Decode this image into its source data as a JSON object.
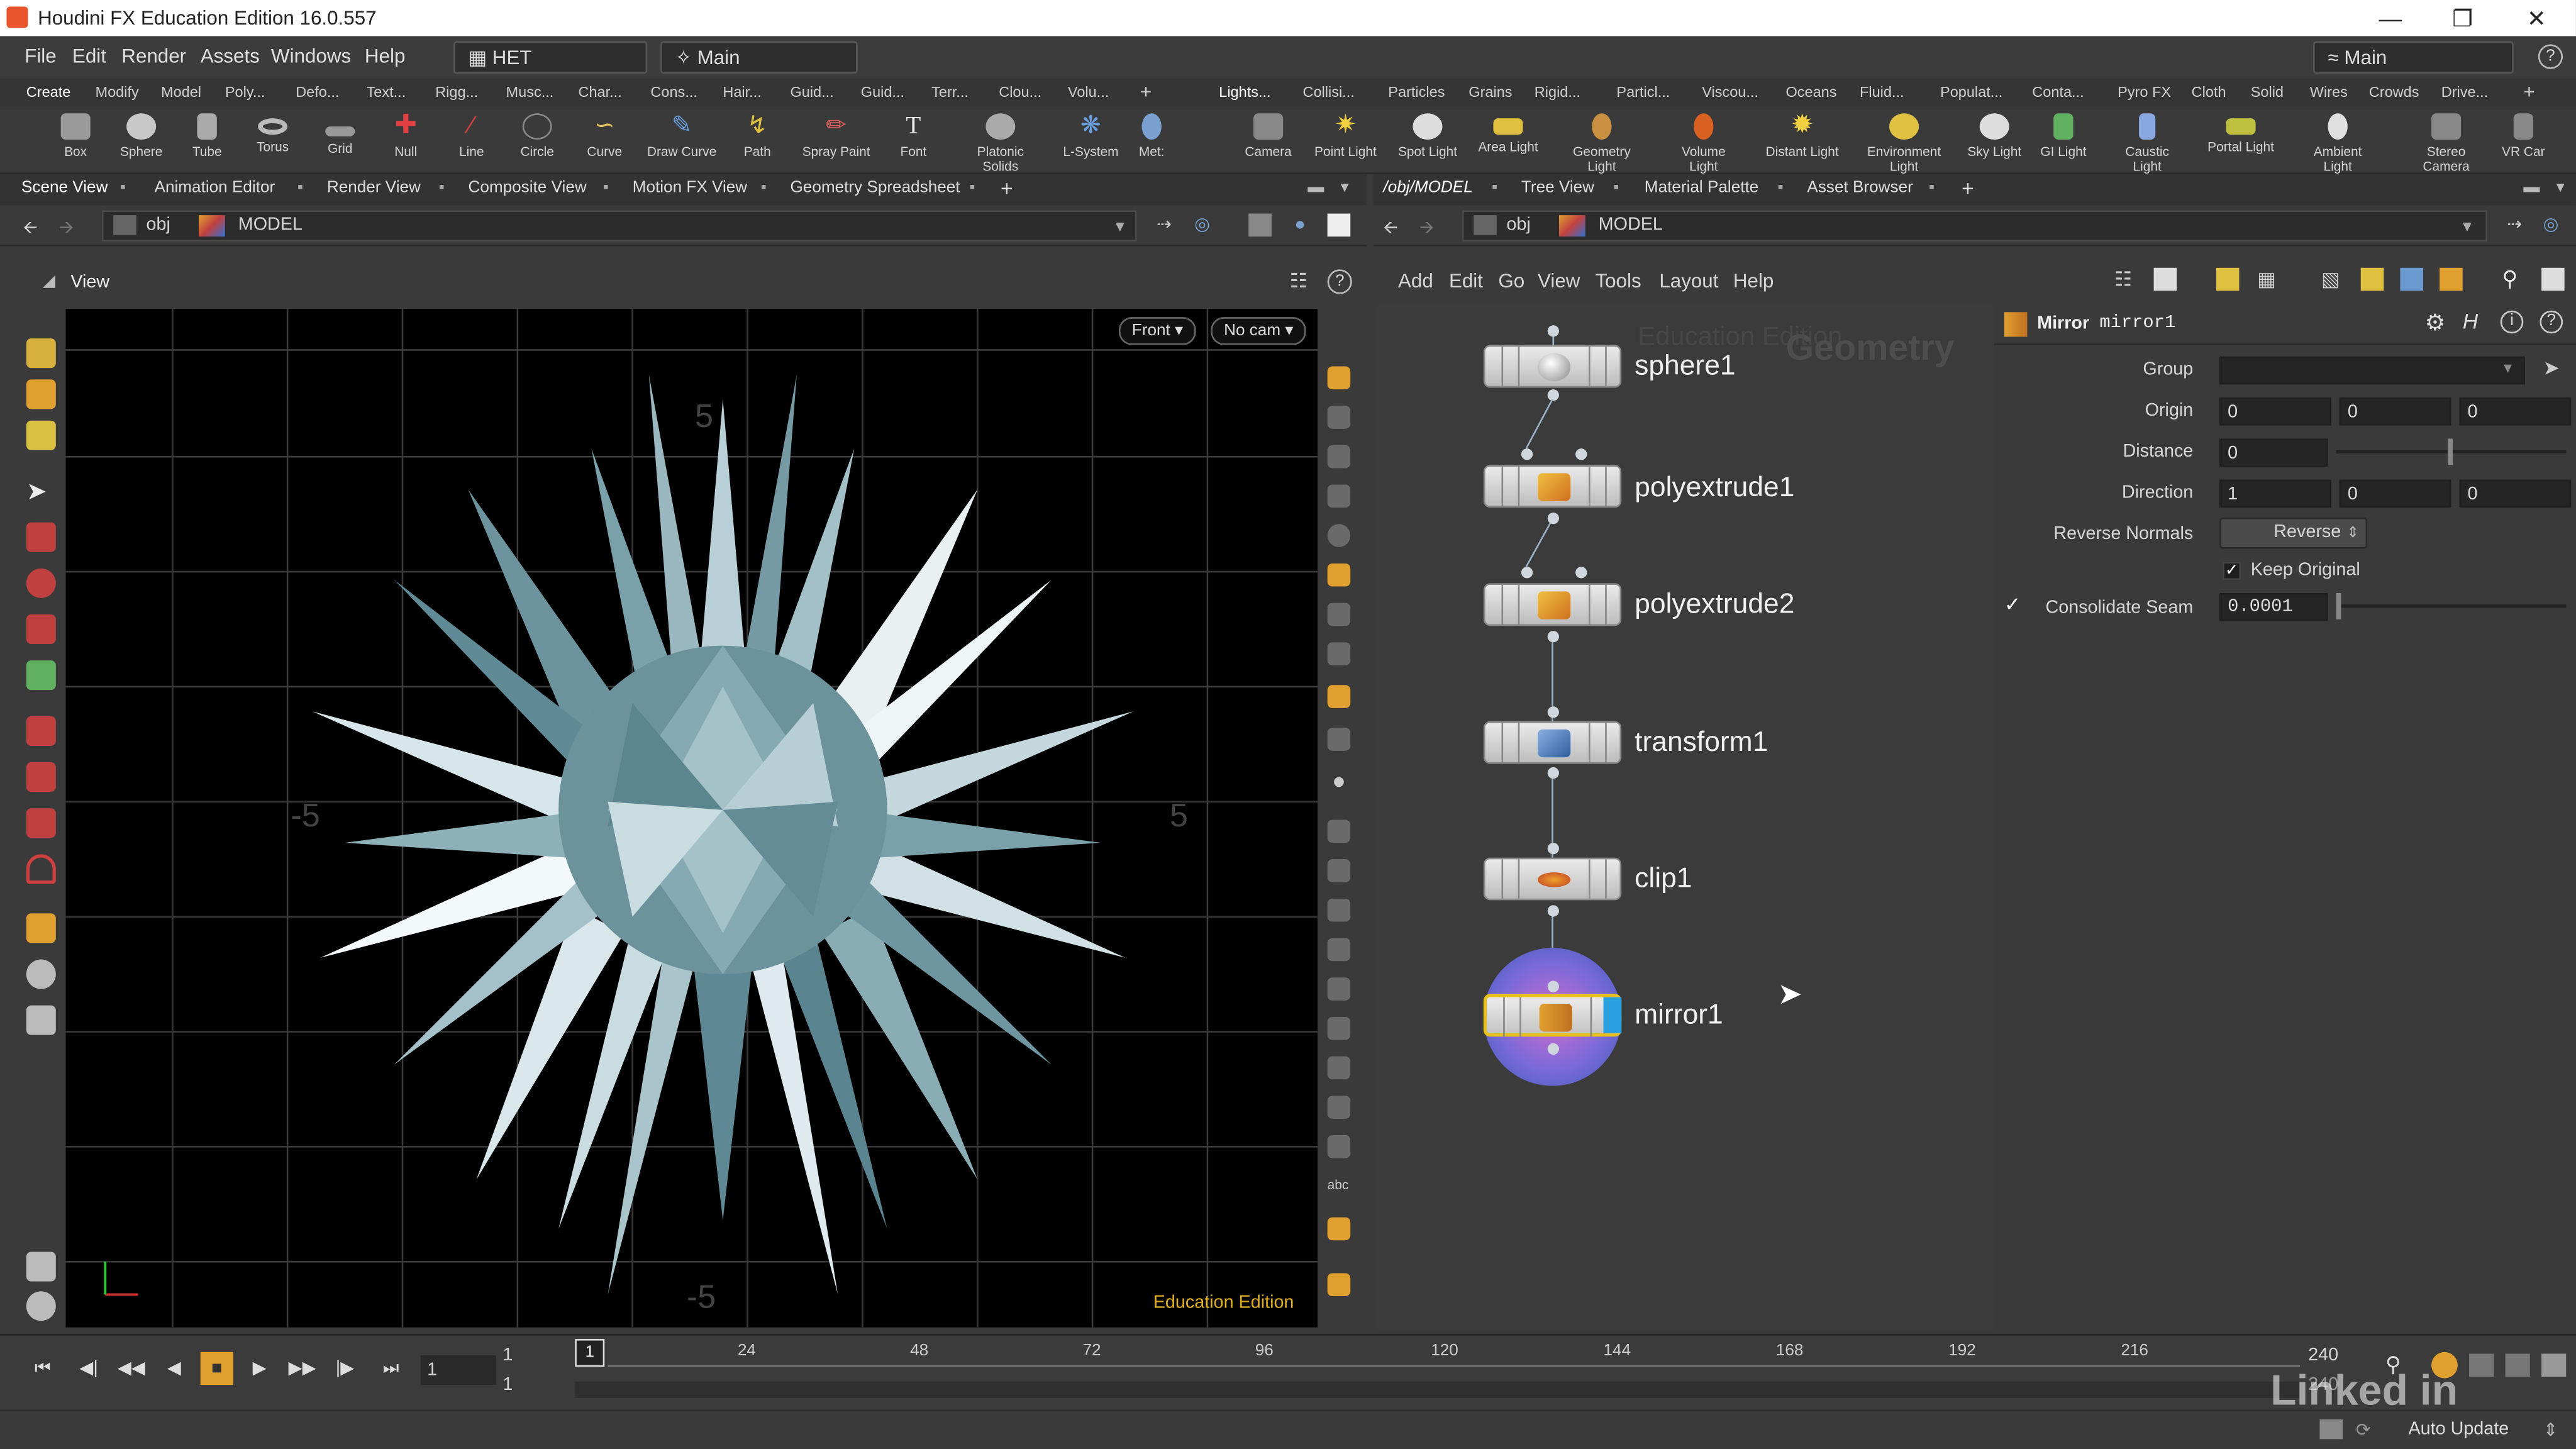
{
  "app": {
    "title": "Houdini FX Education Edition 16.0.557"
  },
  "menu": [
    "File",
    "Edit",
    "Render",
    "Assets",
    "Windows",
    "Help"
  ],
  "desktop": {
    "left_select": "HET",
    "center_select": "Main",
    "right_select": "Main"
  },
  "shelf_left": {
    "tabs": [
      "Create",
      "Modify",
      "Model",
      "Poly...",
      "Defo...",
      "Text...",
      "Rigg...",
      "Musc...",
      "Char...",
      "Cons...",
      "Hair...",
      "Guid...",
      "Guid...",
      "Terr...",
      "Clou...",
      "Volu..."
    ],
    "tools": [
      "Box",
      "Sphere",
      "Tube",
      "Torus",
      "Grid",
      "Null",
      "Line",
      "Circle",
      "Curve",
      "Draw Curve",
      "Path",
      "Spray Paint",
      "Font",
      "Platonic Solids",
      "L-System",
      "Met:"
    ]
  },
  "shelf_right": {
    "tabs": [
      "Lights...",
      "Collisi...",
      "Particles",
      "Grains",
      "Rigid...",
      "Particl...",
      "Viscou...",
      "Oceans",
      "Fluid...",
      "Populat...",
      "Conta...",
      "Pyro FX",
      "Cloth",
      "Solid",
      "Wires",
      "Crowds",
      "Drive..."
    ],
    "tools": [
      "Camera",
      "Point Light",
      "Spot Light",
      "Area Light",
      "Geometry Light",
      "Volume Light",
      "Distant Light",
      "Environment Light",
      "Sky Light",
      "GI Light",
      "Caustic Light",
      "Portal Light",
      "Ambient Light",
      "Stereo Camera",
      "VR Car"
    ]
  },
  "left_pane": {
    "tabs": [
      "Scene View",
      "Animation Editor",
      "Render View",
      "Composite View",
      "Motion FX View",
      "Geometry Spreadsheet"
    ],
    "path": {
      "root": "obj",
      "current": "MODEL"
    },
    "view_label": "View",
    "camera_menus": [
      "Front",
      "No cam"
    ],
    "axis_labels": [
      "5",
      "-5",
      "5",
      "-5"
    ],
    "watermark": "Education Edition"
  },
  "right_pane": {
    "tabs": [
      "/obj/MODEL",
      "Tree View",
      "Material Palette",
      "Asset Browser"
    ],
    "path": {
      "root": "obj",
      "current": "MODEL"
    },
    "net_menu": [
      "Add",
      "Edit",
      "Go",
      "View",
      "Tools",
      "Layout",
      "Help"
    ],
    "context_label": "Geometry",
    "faint_watermark": "Education Edition",
    "nodes": [
      "sphere1",
      "polyextrude1",
      "polyextrude2",
      "transform1",
      "clip1",
      "mirror1"
    ]
  },
  "params": {
    "node_type": "Mirror",
    "node_name": "mirror1",
    "group": {
      "label": "Group",
      "value": ""
    },
    "origin": {
      "label": "Origin",
      "values": [
        "0",
        "0",
        "0"
      ]
    },
    "distance": {
      "label": "Distance",
      "value": "0"
    },
    "direction": {
      "label": "Direction",
      "values": [
        "1",
        "0",
        "0"
      ]
    },
    "reverse_normals": {
      "label": "Reverse Normals",
      "value": "Reverse"
    },
    "keep_original": {
      "label": "Keep Original",
      "checked": true
    },
    "consolidate_seam": {
      "label": "Consolidate Seam",
      "value": "0.0001",
      "checked": true
    }
  },
  "timeline": {
    "current_frame": "1",
    "start": "1",
    "start2": "1",
    "marker": "1",
    "ticks": [
      "24",
      "48",
      "72",
      "96",
      "120",
      "144",
      "168",
      "192",
      "216"
    ],
    "end": "240",
    "end2": "240"
  },
  "status": {
    "auto_update": "Auto Update",
    "brand": "Linked in"
  },
  "colors": {
    "selected_node_border": "#e8c21a",
    "node_ring": "#6b7fd1",
    "accent_orange": "#e0a030"
  }
}
